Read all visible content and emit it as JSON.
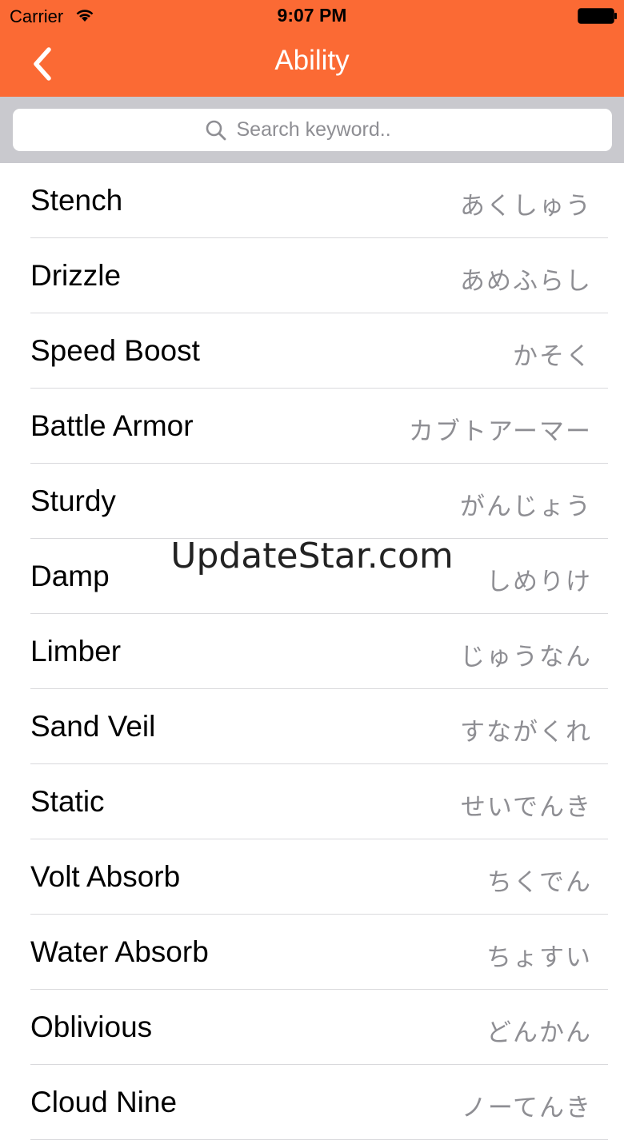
{
  "status_bar": {
    "carrier": "Carrier",
    "time": "9:07 PM"
  },
  "nav": {
    "title": "Ability",
    "back_icon": "chevron-left-icon"
  },
  "search": {
    "placeholder": "Search keyword..",
    "icon": "search-icon"
  },
  "colors": {
    "header": "#fb6a34",
    "search_bg": "#c9c9ce",
    "secondary_text": "#8e8e93"
  },
  "abilities": [
    {
      "name": "Stench",
      "kana": "あくしゅう"
    },
    {
      "name": "Drizzle",
      "kana": "あめふらし"
    },
    {
      "name": "Speed Boost",
      "kana": "かそく"
    },
    {
      "name": "Battle Armor",
      "kana": "カブトアーマー"
    },
    {
      "name": "Sturdy",
      "kana": "がんじょう"
    },
    {
      "name": "Damp",
      "kana": "しめりけ"
    },
    {
      "name": "Limber",
      "kana": "じゅうなん"
    },
    {
      "name": "Sand Veil",
      "kana": "すながくれ"
    },
    {
      "name": "Static",
      "kana": "せいでんき"
    },
    {
      "name": "Volt Absorb",
      "kana": "ちくでん"
    },
    {
      "name": "Water Absorb",
      "kana": "ちょすい"
    },
    {
      "name": "Oblivious",
      "kana": "どんかん"
    },
    {
      "name": "Cloud Nine",
      "kana": "ノーてんき"
    }
  ],
  "watermark": "UpdateStar.com"
}
